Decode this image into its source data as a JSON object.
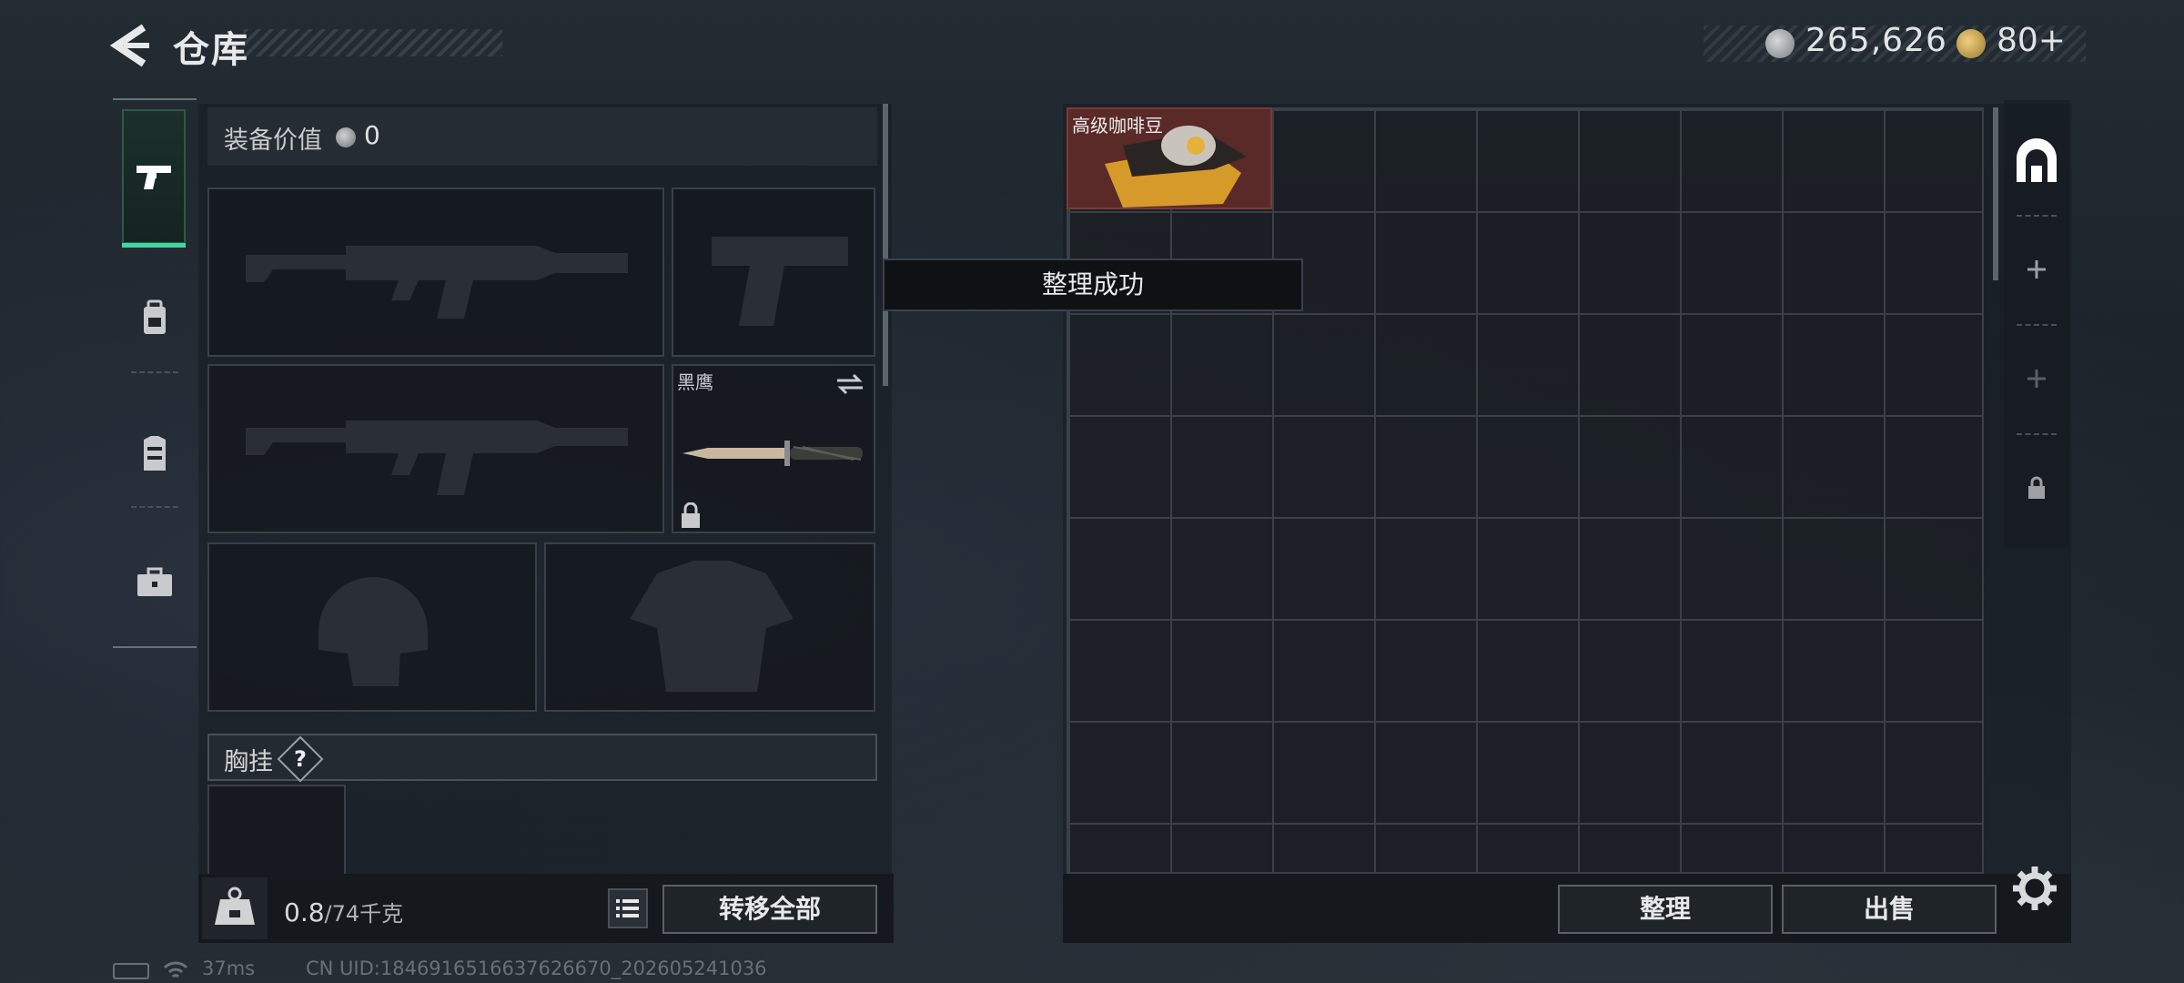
{
  "header": {
    "title": "仓库",
    "currency": {
      "money": "265,626",
      "tickets": "80+"
    }
  },
  "left_nav": {
    "items": [
      {
        "name": "weapons",
        "icon": "pistol-icon",
        "active": true
      },
      {
        "name": "backpack",
        "icon": "backpack-icon",
        "active": false
      },
      {
        "name": "vest",
        "icon": "vest-icon",
        "active": false
      },
      {
        "name": "toolbox",
        "icon": "toolbox-icon",
        "active": false
      }
    ]
  },
  "equipment": {
    "value_label": "装备价值",
    "value": "0",
    "knife_name": "黑鹰",
    "chest_rig_label": "胸挂",
    "help_label": "?"
  },
  "carry": {
    "weight_current": "0.8",
    "weight_max": "/74千克",
    "transfer_all_label": "转移全部"
  },
  "toast": "整理成功",
  "storage": {
    "items": [
      {
        "name": "高级咖啡豆",
        "color": "#5a2a28"
      }
    ],
    "sort_label": "整理",
    "sell_label": "出售"
  },
  "right_nav": {
    "items": [
      {
        "icon": "storage-icon"
      },
      {
        "icon": "plus-icon"
      },
      {
        "icon": "plus-icon"
      },
      {
        "icon": "lock-icon"
      }
    ]
  },
  "status": {
    "ping": "37ms",
    "uid": "CN UID:1846916516637626670_202605241036"
  },
  "colors": {
    "accent": "#3fd8a0",
    "coffee_item": "#5a2a28"
  }
}
